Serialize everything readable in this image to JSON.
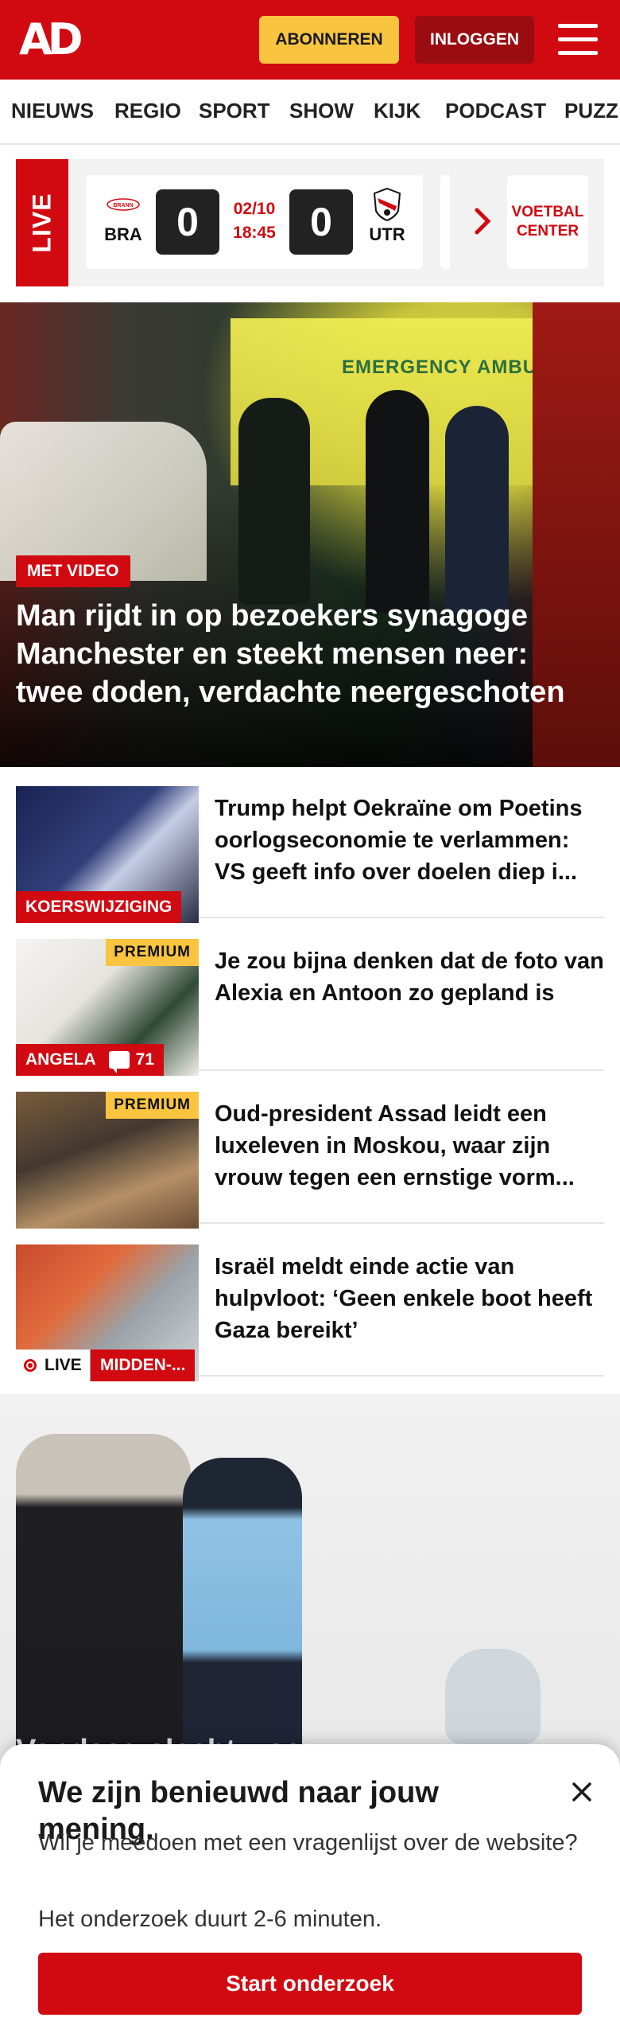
{
  "header": {
    "logo": "AD",
    "subscribe_label": "ABONNEREN",
    "login_label": "INLOGGEN"
  },
  "nav": {
    "items": [
      "NIEUWS",
      "REGIO",
      "SPORT",
      "SHOW",
      "KIJK",
      "PODCAST",
      "PUZZ"
    ]
  },
  "live": {
    "label": "LIVE",
    "match": {
      "home": "BRA",
      "home_crest": "BRANN",
      "home_score": "0",
      "away": "UTR",
      "away_score": "0",
      "date": "02/10",
      "time": "18:45"
    },
    "football_center": "VOETBAL CENTER"
  },
  "hero": {
    "badge": "MET VIDEO",
    "title": "Man rijdt in op bezoekers synagoge Manchester en steekt mensen neer: twee doden, verdachte neergescho­ten",
    "image_text": "EMERGENCY AMBULA"
  },
  "articles": [
    {
      "title": "Trump helpt Oekraïne om Poetins oorlogseconomie te verlammen: VS geeft info over doelen diep i...",
      "label": "KOERSWIJZIGING"
    },
    {
      "title": "Je zou bijna denken dat de foto van Alexia en Antoon zo gepland is",
      "label": "ANGELA",
      "premium": "PREMIUM",
      "comments": "71"
    },
    {
      "title": "Oud-president Assad leidt een luxeleven in Moskou, waar zijn vrouw tegen een ernstige vorm...",
      "premium": "PREMIUM"
    },
    {
      "title": "Israël meldt einde actie van hulpvloot: ‘Geen enkele boot heeft Gaza bereikt’",
      "live": "LIVE",
      "label": "MIDDEN-..."
    }
  ],
  "hero2": {
    "title": "Vandaag slecht weer..."
  },
  "survey": {
    "title": "We zijn benieuwd naar jouw mening.",
    "text": "Wil je meedoen met een vragenlijst over de website?",
    "duration": "Het onderzoek duurt 2-6 minuten.",
    "button": "Start onderzoek"
  },
  "colors": {
    "brand_red": "#d10a11",
    "accent_yellow": "#f9c440"
  }
}
